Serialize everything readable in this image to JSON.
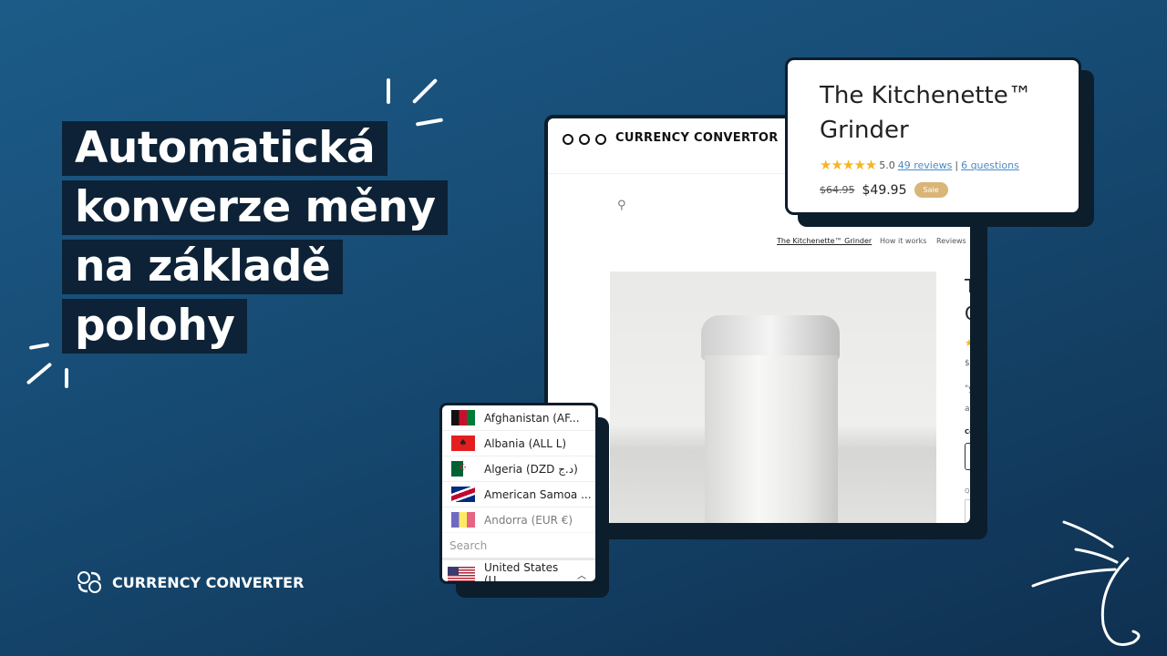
{
  "headline": [
    "Automatická",
    "konverze měny",
    "na základě",
    "polohy"
  ],
  "browser": {
    "title": "CURRENCY CONVERTOR",
    "nav": [
      "The Kitchenette™ Grinder",
      "How it works",
      "Reviews"
    ],
    "partial_text": [
      "T",
      "G",
      "$6",
      "\"y",
      "ar",
      "Co",
      "Qu"
    ]
  },
  "product": {
    "title_line1": "The Kitchenette™",
    "title_line2": "Grinder",
    "rating": "5.0",
    "reviews": "49 reviews",
    "separator": "|",
    "questions": "6 questions",
    "old_price": "$64.95",
    "price": "$49.95",
    "badge": "Sale",
    "stars": 5
  },
  "dropdown": {
    "items": [
      {
        "label": "Afghanistan (AF...",
        "flag": "afghanistan"
      },
      {
        "label": "Albania (ALL L)",
        "flag": "albania"
      },
      {
        "label": "Algeria (DZD د.ج)",
        "flag": "algeria"
      },
      {
        "label": "American Samoa ...",
        "flag": "american-samoa"
      },
      {
        "label": "Andorra (EUR €)",
        "flag": "andorra"
      }
    ],
    "search_placeholder": "Search",
    "selected": "United States (U..."
  },
  "logo": {
    "text": "CURRENCY CONVERTER"
  },
  "colors": {
    "bg": "#1c5b88",
    "dark": "#0d2236",
    "star": "#f5b623",
    "badge": "#d9b577",
    "link": "#4a8bc8"
  }
}
